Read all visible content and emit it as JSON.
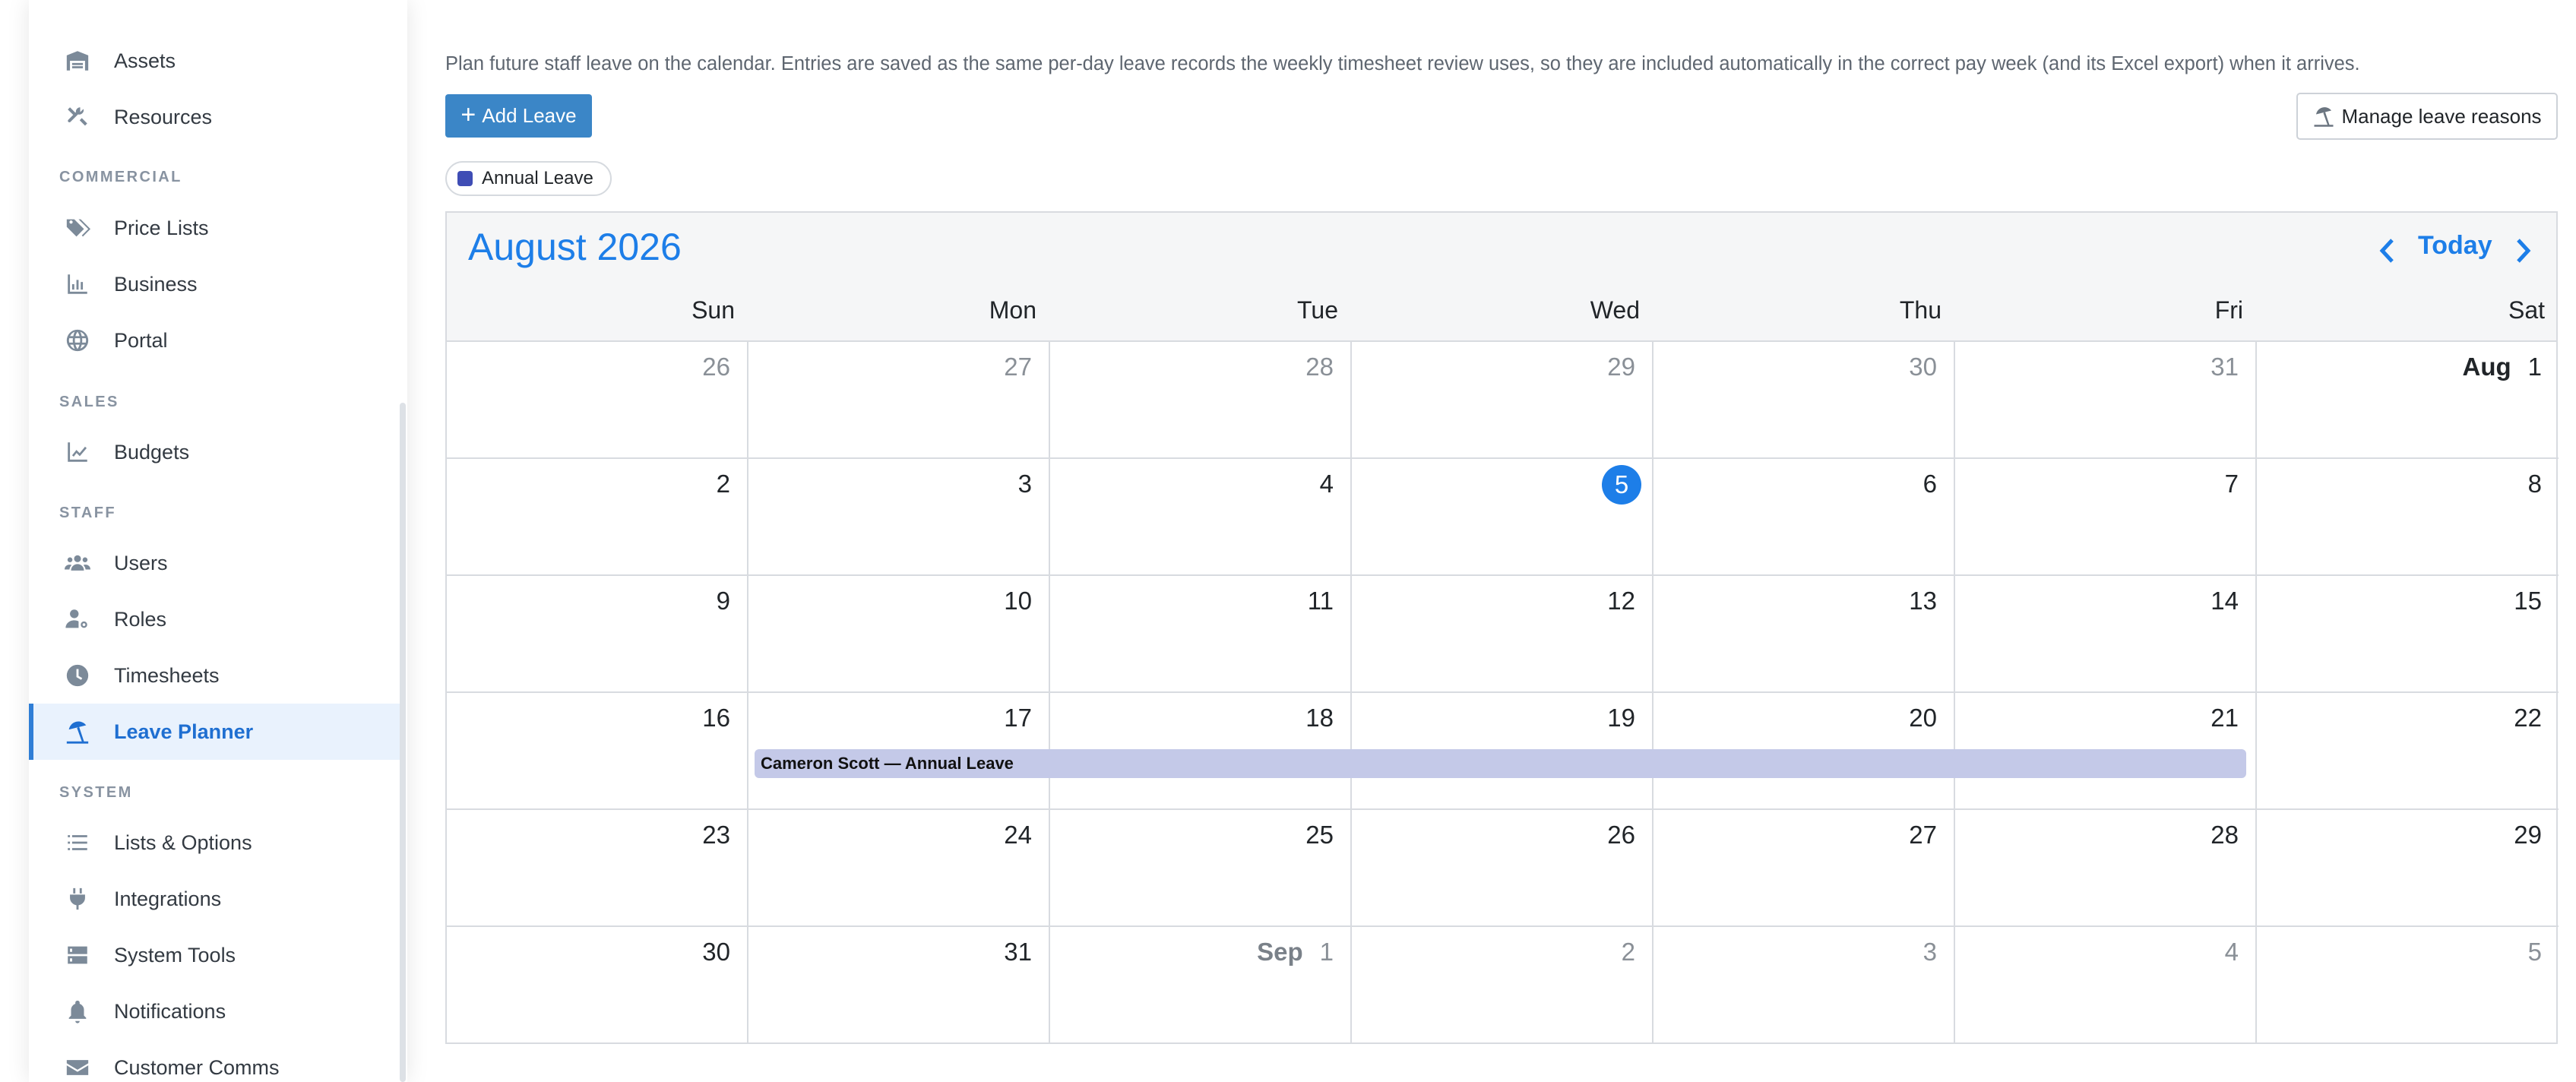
{
  "sidebar": {
    "items": [
      {
        "label": "Assets",
        "icon": "warehouse-icon"
      },
      {
        "label": "Resources",
        "icon": "tools-icon"
      },
      {
        "label": "Price Lists",
        "icon": "tags-icon"
      },
      {
        "label": "Business",
        "icon": "bar-chart-icon"
      },
      {
        "label": "Portal",
        "icon": "globe-icon"
      },
      {
        "label": "Budgets",
        "icon": "line-chart-icon"
      },
      {
        "label": "Users",
        "icon": "users-icon"
      },
      {
        "label": "Roles",
        "icon": "user-cog-icon"
      },
      {
        "label": "Timesheets",
        "icon": "clock-icon"
      },
      {
        "label": "Leave Planner",
        "icon": "umbrella-beach-icon",
        "active": true
      },
      {
        "label": "Lists & Options",
        "icon": "list-icon"
      },
      {
        "label": "Integrations",
        "icon": "plug-icon"
      },
      {
        "label": "System Tools",
        "icon": "server-icon"
      },
      {
        "label": "Notifications",
        "icon": "bell-icon"
      },
      {
        "label": "Customer Comms",
        "icon": "envelope-icon"
      }
    ],
    "sections": [
      "COMMERCIAL",
      "SALES",
      "STAFF",
      "SYSTEM"
    ]
  },
  "main": {
    "intro": "Plan future staff leave on the calendar. Entries are saved as the same per-day leave records the weekly timesheet review uses, so they are included automatically in the correct pay week (and its Excel export) when it arrives.",
    "add_button": "Add Leave",
    "manage_button": "Manage leave reasons",
    "legend": {
      "label": "Annual Leave",
      "color": "#3f4db5"
    }
  },
  "calendar": {
    "title": "August 2026",
    "today_label": "Today",
    "weekdays": [
      "Sun",
      "Mon",
      "Tue",
      "Wed",
      "Thu",
      "Fri",
      "Sat"
    ],
    "weeks": [
      [
        "26",
        "27",
        "28",
        "29",
        "30",
        "31",
        "1"
      ],
      [
        "2",
        "3",
        "4",
        "5",
        "6",
        "7",
        "8"
      ],
      [
        "9",
        "10",
        "11",
        "12",
        "13",
        "14",
        "15"
      ],
      [
        "16",
        "17",
        "18",
        "19",
        "20",
        "21",
        "22"
      ],
      [
        "23",
        "24",
        "25",
        "26",
        "27",
        "28",
        "29"
      ],
      [
        "30",
        "31",
        "1",
        "2",
        "3",
        "4",
        "5"
      ]
    ],
    "month_prefix_aug": "Aug",
    "month_prefix_sep": "Sep",
    "today_date": "5",
    "event": {
      "text": "Cameron Scott — Annual Leave",
      "color": "#c4c9e8"
    },
    "accent_color": "#1d7ee8"
  }
}
